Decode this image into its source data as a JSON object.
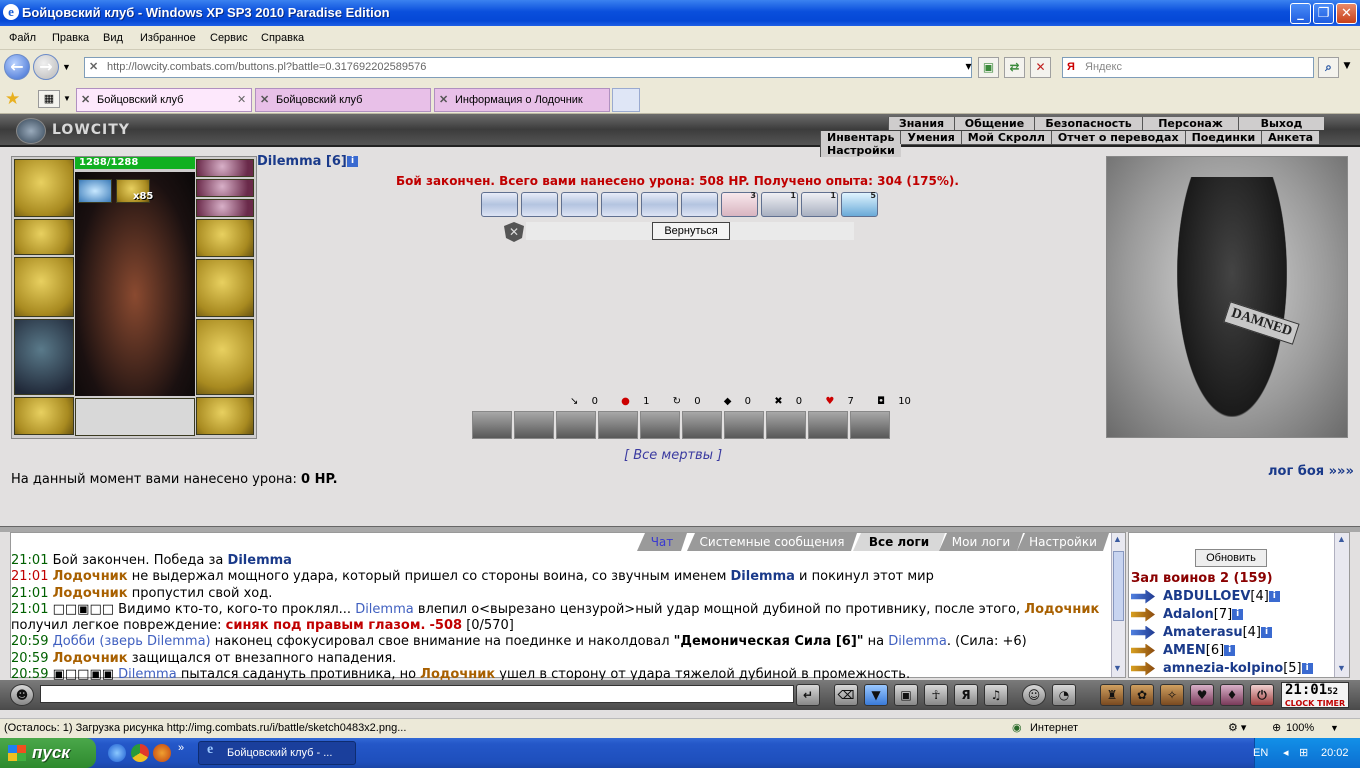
{
  "window": {
    "title": "Бойцовский клуб - Windows XP SP3 2010 Paradise Edition",
    "min": "_",
    "max": "❐",
    "close": "✕"
  },
  "menu": [
    "Файл",
    "Правка",
    "Вид",
    "Избранное",
    "Сервис",
    "Справка"
  ],
  "address": {
    "url": "http://lowcity.combats.com/buttons.pl?battle=0.317692202589576",
    "search_placeholder": "Яндекс"
  },
  "tabs": [
    {
      "label": "Бойцовский клуб",
      "active": true
    },
    {
      "label": "Бойцовский клуб",
      "active": false
    },
    {
      "label": "Информация о Лодочник",
      "active": false
    }
  ],
  "game": {
    "logo": "LOWCITY",
    "nav_row1": [
      "Знания",
      "Общение",
      "Безопасность",
      "Персонаж",
      "Выход"
    ],
    "nav_row2": [
      "Инвентарь",
      "Умения",
      "Мой Скролл",
      "Отчет о переводах",
      "Поединки",
      "Анкета",
      "Настройки"
    ],
    "hp": "1288/1288",
    "level_badge": "x85",
    "player": "Dilemma [6]",
    "battle_result": "Бой закончен. Всего вами нанесено урона: 508 HP. Получено опыта: 304 (175%).",
    "scroll_counts": [
      "",
      "",
      "",
      "",
      "",
      "",
      "3",
      "1",
      "1",
      "5"
    ],
    "return_label": "Вернуться",
    "stats": [
      {
        "icon": "sword-icon",
        "glyph": "↘",
        "value": "0"
      },
      {
        "icon": "blood-icon",
        "glyph": "●",
        "value": "1"
      },
      {
        "icon": "counter-icon",
        "glyph": "↻",
        "value": "0"
      },
      {
        "icon": "block-icon",
        "glyph": "◆",
        "value": "0"
      },
      {
        "icon": "cross-icon",
        "glyph": "✖",
        "value": "0"
      },
      {
        "icon": "heart-icon",
        "glyph": "♥",
        "value": "7"
      },
      {
        "icon": "shield-icon",
        "glyph": "◘",
        "value": "10"
      }
    ],
    "all_dead": "[ Все мертвы ]",
    "damage_now_prefix": "На данный момент вами нанесено урона: ",
    "damage_now_value": "0 HP.",
    "battle_log_link": "лог боя »»»",
    "sign_text": "DAMNED"
  },
  "chat": {
    "tabs": [
      "Чат",
      "Системные сообщения",
      "Все логи",
      "Мои логи",
      "Настройки"
    ],
    "active_tab": "Все логи",
    "lines": [
      {
        "time": "21:01",
        "red": false,
        "parts": [
          [
            "t",
            "Бой закончен. Победа за "
          ],
          [
            "nm",
            "Dilemma"
          ]
        ]
      },
      {
        "time": "21:01",
        "red": true,
        "parts": [
          [
            "en",
            "Лодочник"
          ],
          [
            "t",
            " не выдержал мощного удара, который пришел со стороны воина, со звучным именем "
          ],
          [
            "nm",
            "Dilemma"
          ],
          [
            "t",
            " и покинул этот мир"
          ]
        ]
      },
      {
        "time": "21:01",
        "red": false,
        "parts": [
          [
            "en",
            "Лодочник"
          ],
          [
            "t",
            " пропустил свой ход."
          ]
        ]
      },
      {
        "time": "21:01",
        "red": false,
        "parts": [
          [
            "t",
            "□□▣□□ Видимо кто-то, кого-то проклял... "
          ],
          [
            "bl",
            "Dilemma"
          ],
          [
            "t",
            " влепил о<вырезано цензурой>ный удар мощной дубиной по противнику, после этого, "
          ],
          [
            "en",
            "Лодочник"
          ]
        ]
      },
      {
        "time": "",
        "red": false,
        "parts": [
          [
            "t",
            "получил легкое повреждение: "
          ],
          [
            "dmg",
            "синяк под правым глазом."
          ],
          [
            "t",
            " "
          ],
          [
            "dmg",
            "-508"
          ],
          [
            "t",
            " [0/570]"
          ]
        ]
      },
      {
        "time": "20:59",
        "red": false,
        "parts": [
          [
            "bl",
            "Добби (зверь Dilemma)"
          ],
          [
            "t",
            " наконец сфокусировал свое внимание на поединке и наколдовал "
          ],
          [
            "b",
            "\"Демоническая Сила [6]\""
          ],
          [
            "t",
            " на "
          ],
          [
            "bl",
            "Dilemma"
          ],
          [
            "t",
            ". (Сила: +6)"
          ]
        ]
      },
      {
        "time": "20:59",
        "red": false,
        "parts": [
          [
            "en",
            "Лодочник"
          ],
          [
            "t",
            " защищался от внезапного нападения."
          ]
        ]
      },
      {
        "time": "20:59",
        "red": false,
        "parts": [
          [
            "t",
            "▣□□▣▣ "
          ],
          [
            "bl",
            "Dilemma"
          ],
          [
            "t",
            " пытался садануть противника, но "
          ],
          [
            "en",
            "Лодочник"
          ],
          [
            "t",
            " ушел в сторону от удара тяжелой дубиной в промежность."
          ]
        ]
      }
    ]
  },
  "sidebar": {
    "refresh": "Обновить",
    "hall": "Зал воинов 2 (159)",
    "players": [
      {
        "name": "ABDULLOEV",
        "level": "[4]",
        "icon": "blue"
      },
      {
        "name": "Adalon",
        "level": "[7]",
        "icon": "gold"
      },
      {
        "name": "Amaterasu",
        "level": "[4]",
        "icon": "blue"
      },
      {
        "name": "AMEN",
        "level": "[6]",
        "icon": "gold"
      },
      {
        "name": "amnezia-kolpino",
        "level": "[5]",
        "icon": "gold"
      }
    ]
  },
  "clock": {
    "time": "21:01",
    "sec": "52",
    "label": "CLOCK TIMER"
  },
  "statusbar": {
    "text": "(Осталось: 1) Загрузка рисунка http://img.combats.ru/i/battle/sketch0483x2.png...",
    "zone": "Интернет",
    "zoom": "100%"
  },
  "taskbar": {
    "start": "пуск",
    "task": "Бойцовский клуб - ...",
    "lang": "EN",
    "time": "20:02"
  }
}
